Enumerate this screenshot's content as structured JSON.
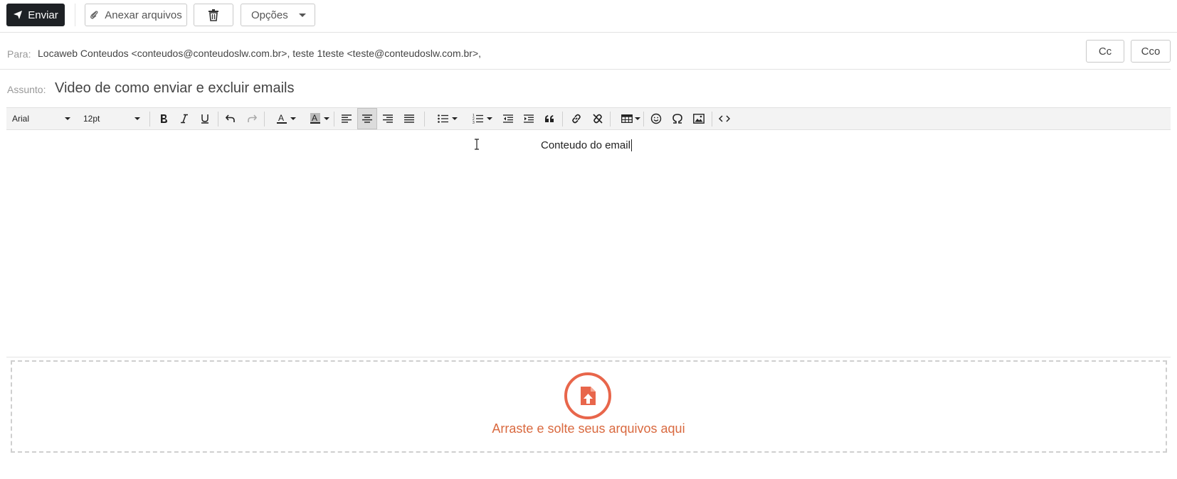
{
  "toolbar": {
    "send_label": "Enviar",
    "attach_label": "Anexar arquivos",
    "options_label": "Opções"
  },
  "to": {
    "label": "Para:",
    "value": "Locaweb Conteudos <conteudos@conteudoslw.com.br>, teste 1teste <teste@conteudoslw.com.br>,",
    "cc_label": "Cc",
    "cco_label": "Cco"
  },
  "subject": {
    "label": "Assunto:",
    "value": "Video de como enviar e excluir emails"
  },
  "editor": {
    "font_family": "Arial",
    "font_size": "12pt",
    "content": "Conteudo do email",
    "icons": [
      "bold-icon",
      "italic-icon",
      "underline-icon",
      "undo-icon",
      "redo-icon",
      "text-color-icon",
      "background-color-icon",
      "align-left-icon",
      "align-center-icon",
      "align-right-icon",
      "justify-icon",
      "bullet-list-icon",
      "numbered-list-icon",
      "outdent-icon",
      "indent-icon",
      "blockquote-icon",
      "link-icon",
      "unlink-icon",
      "table-icon",
      "emoticon-icon",
      "special-char-icon",
      "image-icon",
      "source-code-icon"
    ]
  },
  "dropzone": {
    "text": "Arraste e solte seus arquivos aqui"
  },
  "colors": {
    "accent": "#e8664b",
    "send_button": "#1e2125"
  }
}
